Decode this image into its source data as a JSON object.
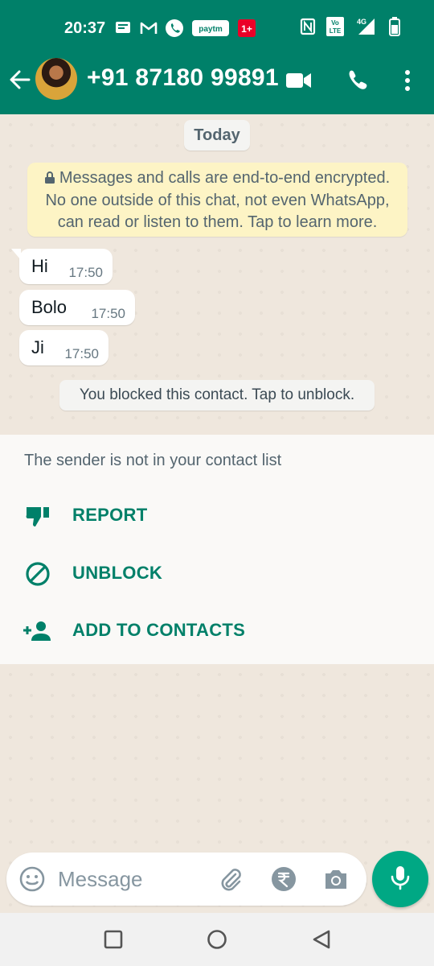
{
  "status_bar": {
    "time": "20:37",
    "left_icons": [
      "message-icon",
      "gmail-icon",
      "phone-icon",
      "paytm-icon",
      "oneplus-icon"
    ],
    "right_icons": [
      "nfc-icon",
      "volte-icon",
      "signal-icon",
      "battery-icon"
    ],
    "network": "4G",
    "paytm_text": "paytm",
    "volte_text": "Vo LTE"
  },
  "header": {
    "contact_name": "+91 87180 99891",
    "accent_color": "#008069"
  },
  "chat": {
    "date_chip": "Today",
    "encryption_notice": "Messages and calls are end-to-end encrypted. No one outside of this chat, not even WhatsApp, can read or listen to them. Tap to learn more.",
    "messages": [
      {
        "text": "Hi",
        "time": "17:50"
      },
      {
        "text": "Bolo",
        "time": "17:50"
      },
      {
        "text": "Ji",
        "time": "17:50"
      }
    ],
    "blocked_notice": "You blocked this contact. Tap to unblock."
  },
  "panel": {
    "note": "The sender is not in your contact list",
    "options": [
      {
        "label": "REPORT",
        "icon": "thumbs-down-icon"
      },
      {
        "label": "UNBLOCK",
        "icon": "block-icon"
      },
      {
        "label": "ADD TO CONTACTS",
        "icon": "add-person-icon"
      }
    ]
  },
  "composer": {
    "placeholder": "Message",
    "icons": [
      "emoji-icon",
      "attach-icon",
      "rupee-icon",
      "camera-icon",
      "mic-icon"
    ]
  }
}
